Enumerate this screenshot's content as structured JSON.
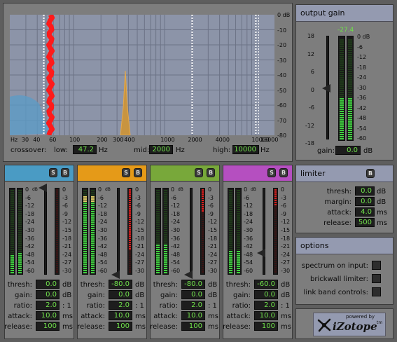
{
  "spectrum": {
    "db_labels": [
      "0 dB",
      "-10",
      "-20",
      "-30",
      "-40",
      "-50",
      "-60",
      "-70",
      "-80"
    ],
    "freq_labels": [
      "Hz",
      "30",
      "40",
      "60",
      "100",
      "200",
      "300",
      "400",
      "1000",
      "2000",
      "4000",
      "10000",
      "16000"
    ],
    "crossover_label": "crossover:",
    "low_label": "low:",
    "low_value": "47.2",
    "low_unit": "Hz",
    "mid_label": "mid:",
    "mid_value": "2000",
    "mid_unit": "Hz",
    "high_label": "high:",
    "high_value": "10000",
    "high_unit": "Hz"
  },
  "output_gain": {
    "title": "output gain",
    "peak_value": "-27.4",
    "scale": [
      "0 dB",
      "-6",
      "-12",
      "-18",
      "-24",
      "-30",
      "-36",
      "-42",
      "-48",
      "-54",
      "-60"
    ],
    "fader_scale": [
      "18",
      "12",
      "6",
      "0",
      "-6",
      "-12",
      "-18"
    ],
    "gain_label": "gain:",
    "gain_value": "0.0",
    "gain_unit": "dB",
    "level": 0.42
  },
  "bands": [
    {
      "color": "#4a9bc4",
      "thresh": "0.0",
      "gain": "0.0",
      "ratio": "2.0",
      "attack": "10.0",
      "release": "100",
      "levels": [
        0.22,
        0.24
      ],
      "gr_red": 0,
      "gr_len": 0
    },
    {
      "color": "#e59a18",
      "thresh": "-80.0",
      "gain": "0.0",
      "ratio": "2.0",
      "attack": "10.0",
      "release": "100",
      "levels": [
        0.93,
        0.93
      ],
      "gr_red": 1,
      "gr_len": 0.72
    },
    {
      "color": "#78a83a",
      "thresh": "-80.0",
      "gain": "0.0",
      "ratio": "2.0",
      "attack": "10.0",
      "release": "100",
      "levels": [
        0.34,
        0.34
      ],
      "gr_red": 1,
      "gr_len": 0.28
    },
    {
      "color": "#b54fc0",
      "thresh": "-60.0",
      "gain": "0.0",
      "ratio": "2.0",
      "attack": "10.0",
      "release": "100",
      "levels": [
        0.27,
        0.27
      ],
      "gr_red": 1,
      "gr_len": 0.2
    }
  ],
  "band_labels": {
    "solo": "S",
    "bypass": "B",
    "thresh": "thresh:",
    "gain": "gain:",
    "ratio": "ratio:",
    "attack": "attack:",
    "release": "release:",
    "db": "dB",
    "ratio_unit": ": 1",
    "ms": "ms"
  },
  "band_scale_left": [
    "0",
    "-6",
    "-12",
    "-18",
    "-24",
    "-30",
    "-36",
    "-42",
    "-48",
    "-54",
    "-60"
  ],
  "band_scale_db": "dB",
  "band_scale_right": [
    "0",
    "-3",
    "-6",
    "-9",
    "-12",
    "-15",
    "-18",
    "-21",
    "-24",
    "-27",
    "-30"
  ],
  "limiter": {
    "title": "limiter",
    "bypass": "B",
    "thresh_label": "thresh:",
    "thresh_value": "0.0",
    "thresh_unit": "dB",
    "margin_label": "margin:",
    "margin_value": "0.0",
    "margin_unit": "dB",
    "attack_label": "attack:",
    "attack_value": "4.0",
    "attack_unit": "ms",
    "release_label": "release:",
    "release_value": "500",
    "release_unit": "ms"
  },
  "options": {
    "title": "options",
    "spectrum_label": "spectrum on input:",
    "brickwall_label": "brickwall limiter:",
    "link_label": "link band controls:"
  },
  "logo": {
    "powered": "powered by",
    "brand": "iZotope",
    "tm": "tm"
  }
}
